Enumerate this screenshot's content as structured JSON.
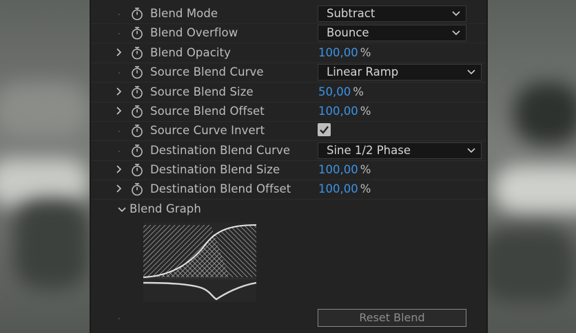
{
  "effect_controls": {
    "properties": [
      {
        "label": "Blend Mode",
        "expandable": false,
        "control": "dropdown",
        "value": "Subtract"
      },
      {
        "label": "Blend Overflow",
        "expandable": false,
        "control": "dropdown",
        "value": "Bounce"
      },
      {
        "label": "Blend Opacity",
        "expandable": true,
        "control": "number",
        "value": "100,00",
        "unit": "%"
      },
      {
        "label": "Source Blend Curve",
        "expandable": false,
        "control": "dropdown",
        "value": "Linear Ramp"
      },
      {
        "label": "Source Blend Size",
        "expandable": true,
        "control": "number",
        "value": "50,00",
        "unit": "%"
      },
      {
        "label": "Source Blend Offset",
        "expandable": true,
        "control": "number",
        "value": "100,00",
        "unit": "%"
      },
      {
        "label": "Source Curve Invert",
        "expandable": false,
        "control": "checkbox",
        "checked": true
      },
      {
        "label": "Destination Blend Curve",
        "expandable": false,
        "control": "dropdown",
        "value": "Sine 1/2 Phase"
      },
      {
        "label": "Destination Blend Size",
        "expandable": true,
        "control": "number",
        "value": "100,00",
        "unit": "%"
      },
      {
        "label": "Destination Blend Offset",
        "expandable": true,
        "control": "number",
        "value": "100,00",
        "unit": "%"
      }
    ],
    "graph_section_label": "Blend Graph",
    "reset_button_label": "Reset Blend"
  },
  "icons": {
    "twirl_closed": "chevron-right-icon",
    "twirl_open": "chevron-down-icon",
    "stopwatch": "stopwatch-icon",
    "dropdown_arrow": "chevron-down-icon",
    "checkmark": "checkmark-icon"
  },
  "colors": {
    "panel_bg": "#232323",
    "value_blue": "#3c93e6",
    "label_text": "#bdbdbd"
  }
}
